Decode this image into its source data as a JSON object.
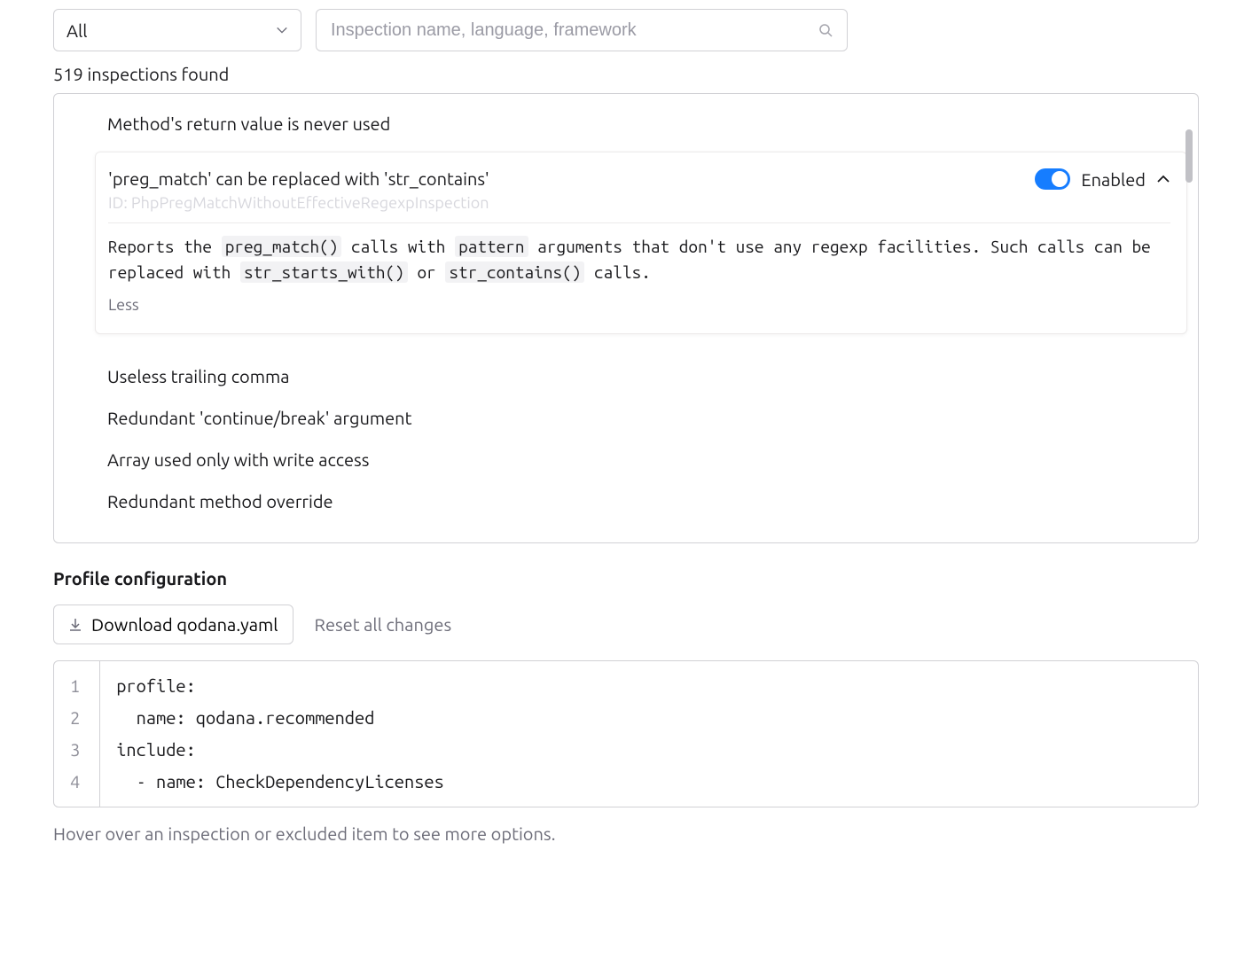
{
  "filter": {
    "dropdown_value": "All",
    "search_placeholder": "Inspection name, language, framework"
  },
  "results_count": "519 inspections found",
  "inspections": {
    "items": [
      "Method's return value is never used",
      "Useless trailing comma",
      "Redundant 'continue/break' argument",
      "Array used only with write access",
      "Redundant method override"
    ],
    "selected": {
      "title": "'preg_match' can be replaced with 'str_contains'",
      "id_label": "ID: PhpPregMatchWithoutEffectiveRegexpInspection",
      "enabled_label": "Enabled",
      "enabled": true,
      "description_parts": {
        "p1": "Reports the ",
        "c1": "preg_match()",
        "p2": " calls with ",
        "c2": "pattern",
        "p3": " arguments that don't use any regexp facilities. Such calls can be replaced with ",
        "c3": "str_starts_with()",
        "p4": " or ",
        "c4": "str_contains()",
        "p5": " calls."
      },
      "less_label": "Less"
    }
  },
  "profile_config": {
    "title": "Profile configuration",
    "download_label": "Download qodana.yaml",
    "reset_label": "Reset all changes",
    "code_lines": [
      "profile:",
      "  name: qodana.recommended",
      "include:",
      "  - name: CheckDependencyLicenses"
    ]
  },
  "hint": "Hover over an inspection or excluded item to see more options."
}
